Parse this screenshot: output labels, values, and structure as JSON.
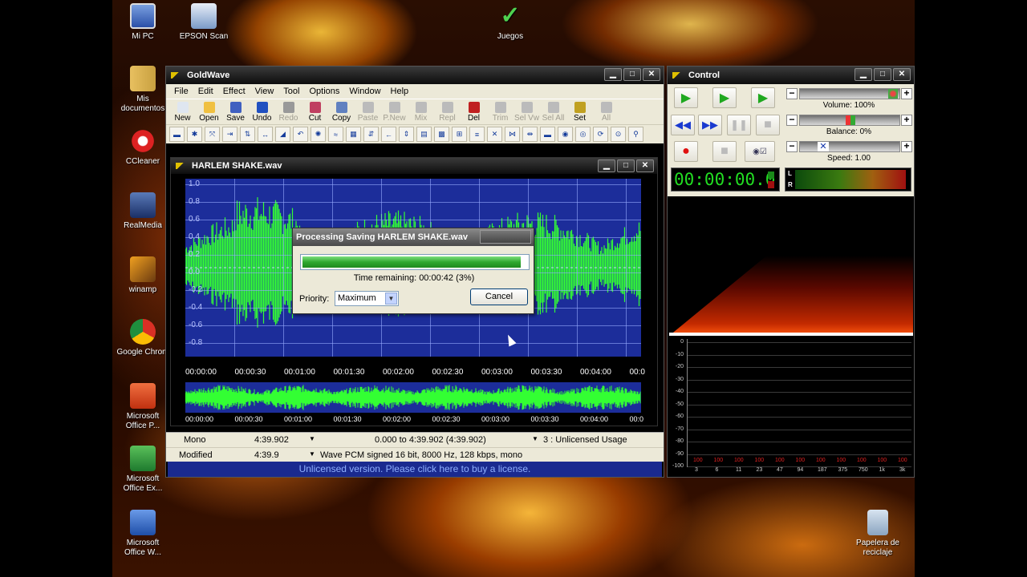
{
  "desktop": {
    "icons": [
      {
        "label": "Mi PC"
      },
      {
        "label": "EPSON Scan"
      },
      {
        "label": "Juegos"
      },
      {
        "label": "Mis documentos"
      },
      {
        "label": "CCleaner"
      },
      {
        "label": "RealMedia"
      },
      {
        "label": "winamp"
      },
      {
        "label": "Google Chrom"
      },
      {
        "label": "Microsoft Office P..."
      },
      {
        "label": "Microsoft Office Ex..."
      },
      {
        "label": "Microsoft Office W..."
      },
      {
        "label": "Papelera de reciclaje"
      }
    ]
  },
  "goldwave": {
    "title": "GoldWave",
    "menu": [
      "File",
      "Edit",
      "Effect",
      "View",
      "Tool",
      "Options",
      "Window",
      "Help"
    ],
    "toolbar": [
      {
        "label": "New",
        "enabled": true
      },
      {
        "label": "Open",
        "enabled": true
      },
      {
        "label": "Save",
        "enabled": true
      },
      {
        "label": "Undo",
        "enabled": true
      },
      {
        "label": "Redo",
        "enabled": false
      },
      {
        "label": "Cut",
        "enabled": true
      },
      {
        "label": "Copy",
        "enabled": true
      },
      {
        "label": "Paste",
        "enabled": false
      },
      {
        "label": "P.New",
        "enabled": false
      },
      {
        "label": "Mix",
        "enabled": false
      },
      {
        "label": "Repl",
        "enabled": false
      },
      {
        "label": "Del",
        "enabled": true
      },
      {
        "label": "Trim",
        "enabled": false
      },
      {
        "label": "Sel Vw",
        "enabled": false
      },
      {
        "label": "Sel All",
        "enabled": false
      },
      {
        "label": "Set",
        "enabled": true
      },
      {
        "label": "All",
        "enabled": false
      }
    ],
    "sound": {
      "title": "HARLEM SHAKE.wav",
      "y_labels": [
        "1.0",
        "0.8",
        "0.6",
        "0.4",
        "0.2",
        "0.0",
        "-0.2",
        "-0.4",
        "-0.6",
        "-0.8"
      ],
      "timeline": [
        "00:00:00",
        "00:00:30",
        "00:01:00",
        "00:01:30",
        "00:02:00",
        "00:02:30",
        "00:03:00",
        "00:03:30",
        "00:04:00",
        "00:0"
      ],
      "timeline2": [
        "00:00:00",
        "00:00:30",
        "00:01:00",
        "00:01:30",
        "00:02:00",
        "00:02:30",
        "00:03:00",
        "00:03:30",
        "00:04:00",
        "00:0"
      ]
    },
    "status": {
      "channel": "Mono",
      "length": "4:39.902",
      "range": "0.000 to 4:39.902 (4:39.902)",
      "usage": "3 : Unlicensed Usage",
      "state": "Modified",
      "position": "4:39.9",
      "format": "Wave PCM signed 16 bit, 8000 Hz, 128 kbps, mono",
      "license_banner": "Unlicensed version. Please click here to buy a license."
    }
  },
  "dialog": {
    "title": "Processing Saving HARLEM SHAKE.wav",
    "progress_fraction": 0.97,
    "time_remaining": "Time remaining: 00:00:42 (3%)",
    "priority_label": "Priority:",
    "priority_value": "Maximum",
    "cancel_label": "Cancel"
  },
  "control": {
    "title": "Control",
    "volume_label": "Volume: 100%",
    "balance_label": "Balance: 0%",
    "speed_label": "Speed: 1.00",
    "time_display": "00:00:00.0",
    "meter_left": "L",
    "meter_right": "R",
    "spectrum_y": [
      "0",
      "-10",
      "-20",
      "-30",
      "-40",
      "-50",
      "-60",
      "-70",
      "-80",
      "-90",
      "-100"
    ],
    "spectrum_x": [
      "3",
      "6",
      "11",
      "23",
      "47",
      "94",
      "187",
      "375",
      "750",
      "1k",
      "3k"
    ],
    "spectrum_vals": [
      "100",
      "100",
      "100",
      "100",
      "100",
      "100",
      "100",
      "100",
      "100",
      "100",
      "100"
    ]
  },
  "colors": {
    "wave": "#33ff33",
    "wave_bg": "#1c2d9a",
    "license_bg": "#1a2a8f",
    "time_display": "#22dd22"
  }
}
